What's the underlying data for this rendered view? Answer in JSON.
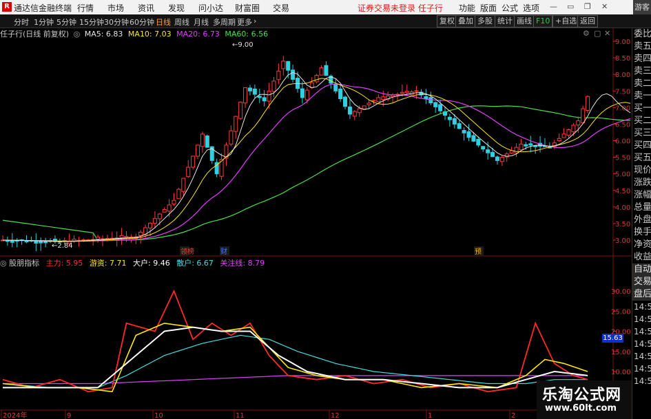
{
  "titlebar": {
    "logo": "R",
    "app_title": "通达信金融终端",
    "menus": [
      "行情",
      "市场",
      "资讯",
      "发现",
      "问小达",
      "财富圈",
      "交易"
    ],
    "login_notice": "证券交易未登录  任子行",
    "right_menus": [
      "功能",
      "版面",
      "公式",
      "选项"
    ],
    "guest": "游客"
  },
  "toolbar": {
    "periods": [
      "分时",
      "1分钟",
      "5分钟",
      "15分钟",
      "30分钟",
      "60分钟",
      "日线",
      "周线",
      "月线",
      "多周期",
      "更多"
    ],
    "active_period": "日线",
    "right_buttons": [
      "复权",
      "叠加",
      "多股",
      "统计",
      "画线",
      "F10",
      "+自选",
      "返回"
    ]
  },
  "main_legend": {
    "stock": "任子行(日线 前复权)",
    "items": [
      {
        "label": "MA5: 6.83",
        "color": "#e6e6e6"
      },
      {
        "label": "MA10: 7.03",
        "color": "#ffea00"
      },
      {
        "label": "MA20: 6.73",
        "color": "#e040fb"
      },
      {
        "label": "MA60: 6.56",
        "color": "#4be04b"
      }
    ]
  },
  "price_axis": [
    "9.00",
    "8.50",
    "8.00",
    "7.50",
    "7.00",
    "6.50",
    "6.00",
    "5.50",
    "5.00",
    "4.50",
    "4.00",
    "3.50",
    "3.00"
  ],
  "annotations": {
    "high": "9.00",
    "low": "2.84"
  },
  "markers": [
    {
      "label": "领榜",
      "color": "#ff3a3a"
    },
    {
      "label": "财",
      "color": "#3a78ff"
    },
    {
      "label": "预",
      "color": "#ffb000"
    }
  ],
  "indicator_legend": {
    "name": "股朋指标",
    "items": [
      {
        "label": "主力: 5.95",
        "color": "#ff2a2a"
      },
      {
        "label": "游资: 7.71",
        "color": "#ffea00"
      },
      {
        "label": "大户: 9.46",
        "color": "#ffffff"
      },
      {
        "label": "散户: 6.67",
        "color": "#40e0e0"
      },
      {
        "label": "关注线: 8.79",
        "color": "#e040fb"
      }
    ]
  },
  "indicator_axis": [
    "30.00",
    "25.00",
    "20.00",
    "15.00",
    "10.00"
  ],
  "indicator_value_tag": "15.63",
  "date_axis": [
    "2024年",
    "9",
    "10",
    "11",
    "12",
    "1",
    "2"
  ],
  "sidebar": [
    "委比",
    "卖五",
    "卖四",
    "卖三",
    "卖二",
    "卖一",
    "买一",
    "买二",
    "买三",
    "买四",
    "买五",
    "现价",
    "涨跌",
    "涨幅",
    "总量",
    "外盘",
    "换手",
    "净资",
    "收益",
    "自动",
    "交易",
    "盘后",
    "14:56",
    "14:56",
    "14:56",
    "14:56",
    "14:56",
    "14:56",
    "14:56"
  ],
  "watermark": {
    "title": "乐淘公式网",
    "url": "www.60lt.com"
  }
}
